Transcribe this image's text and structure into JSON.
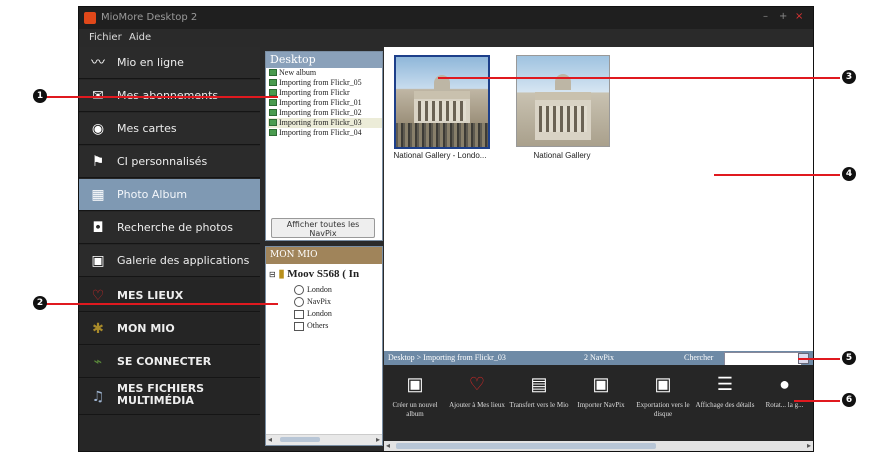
{
  "window": {
    "title": "MioMore Desktop 2",
    "controls": [
      "–",
      "+",
      "×"
    ]
  },
  "menu": [
    "Fichier",
    "Aide"
  ],
  "sidebar": {
    "items": [
      {
        "label": "Mio en ligne",
        "icon": "signature-icon"
      },
      {
        "label": "Mes abonnements",
        "icon": "envelope-icon"
      },
      {
        "label": "Mes cartes",
        "icon": "compass-icon"
      },
      {
        "label": "CI personnalisés",
        "icon": "poi-flag-icon"
      },
      {
        "label": "Photo Album",
        "icon": "photo-album-icon",
        "active": true
      },
      {
        "label": "Recherche de photos",
        "icon": "camera-icon"
      },
      {
        "label": "Galerie des applications",
        "icon": "apps-grid-icon"
      },
      {
        "label": "MES LIEUX",
        "icon": "heart-icon"
      },
      {
        "label": "MON MIO",
        "icon": "gear-icon"
      },
      {
        "label": "SE CONNECTER",
        "icon": "plug-icon"
      },
      {
        "label": "MES FICHIERS MULTIMÉDIA",
        "icon": "music-note-icon"
      }
    ]
  },
  "desktop_panel": {
    "title": "Desktop",
    "items": [
      "New album",
      "Importing from Flickr_05",
      "Importing from Flickr",
      "Importing from Flickr_01",
      "Importing from Flickr_02",
      "Importing from Flickr_03",
      "Importing from Flickr_04"
    ],
    "selected_index": 5,
    "show_all_button": "Afficher toutes les NavPix"
  },
  "monmio_panel": {
    "title": "MON MIO",
    "root": "Moov S568 ( In",
    "children": [
      "London",
      "NavPix",
      "London",
      "Others"
    ]
  },
  "photos": [
    {
      "caption": "National Gallery - Londo...",
      "selected": true
    },
    {
      "caption": "National Gallery",
      "selected": false
    }
  ],
  "status_bar": {
    "breadcrumb": "Desktop > Importing from Flickr_03",
    "count": "2 NavPix",
    "search_label": "Chercher",
    "search_value": ""
  },
  "toolbar": [
    {
      "label": "Créer un nouvel album",
      "icon": "create-album-icon"
    },
    {
      "label": "Ajouter à Mes lieux",
      "icon": "add-to-places-icon"
    },
    {
      "label": "Transfert vers le Mio",
      "icon": "transfer-to-mio-icon"
    },
    {
      "label": "Importer NavPix",
      "icon": "import-navpix-icon"
    },
    {
      "label": "Exportation vers le disque",
      "icon": "export-disk-icon"
    },
    {
      "label": "Affichage des détails",
      "icon": "details-list-icon"
    },
    {
      "label": "Rotat... la g...",
      "icon": "rotate-icon"
    }
  ],
  "callouts": [
    "1",
    "2",
    "3",
    "4",
    "5",
    "6"
  ],
  "colors": {
    "accent_active": "#7f99b3",
    "callout_red": "#e0191f",
    "brand_orange": "#e0481a"
  }
}
